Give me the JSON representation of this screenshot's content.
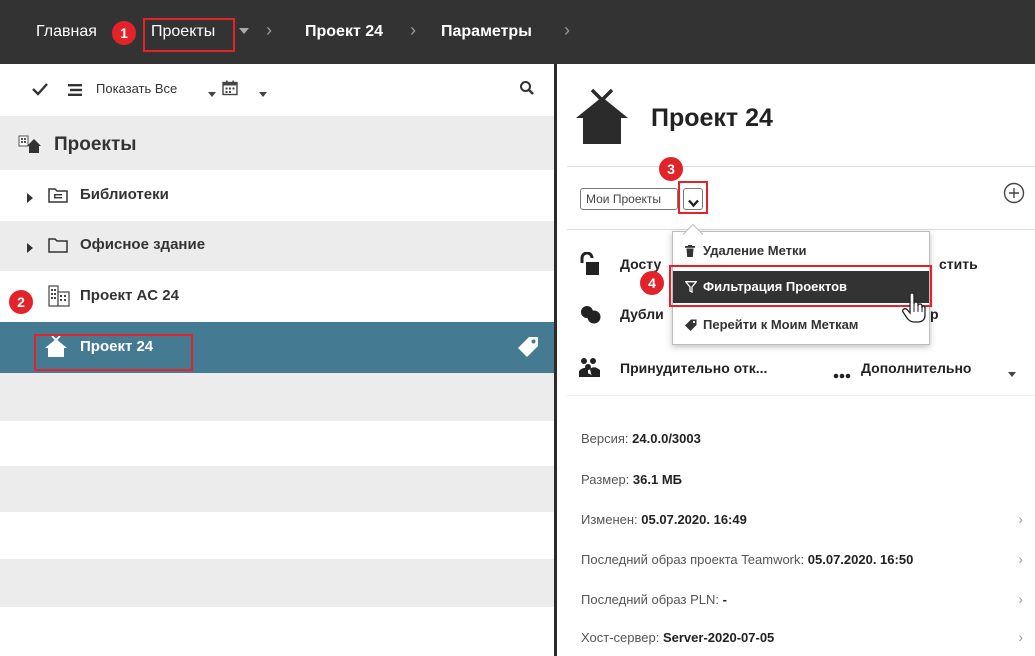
{
  "breadcrumb": {
    "home": "Главная",
    "projects": "Проекты",
    "project": "Проект 24",
    "settings": "Параметры"
  },
  "toolbar": {
    "show_all": "Показать Все"
  },
  "tree": {
    "root": "Проекты",
    "items": [
      {
        "label": "Библиотеки",
        "icon": "library-folder-icon"
      },
      {
        "label": "Офисное здание",
        "icon": "folder-icon"
      },
      {
        "label": "Проект AC 24",
        "icon": "building-icon"
      },
      {
        "label": "Проект 24",
        "icon": "house-icon",
        "selected": true
      }
    ]
  },
  "details": {
    "title": "Проект 24",
    "filter_value": "Мои Проекты",
    "action_access": "Досту",
    "action_access_tail": "стить",
    "action_duplicate": "Дубли",
    "action_duplicate_tail": "р",
    "action_force": "Принудительно отк...",
    "action_more": "Дополнительно",
    "info": [
      {
        "label": "Версия:",
        "value": "24.0.0/3003",
        "chevron": false
      },
      {
        "label": "Размер:",
        "value": "36.1 МБ",
        "chevron": false
      },
      {
        "label": "Изменен:",
        "value": "05.07.2020. 16:49",
        "chevron": true
      },
      {
        "label": "Последний образ проекта Teamwork:",
        "value": "05.07.2020. 16:50",
        "chevron": true
      },
      {
        "label": "Последний образ PLN:",
        "value": "-",
        "chevron": true
      },
      {
        "label": "Хост-сервер:",
        "value": "Server-2020-07-05",
        "chevron": true
      }
    ]
  },
  "menu": {
    "items": [
      "Удаление Метки",
      "Фильтрация Проектов",
      "Перейти к Моим Меткам"
    ]
  },
  "callouts": [
    "1",
    "2",
    "3",
    "4"
  ],
  "colors": {
    "topbar": "#333333",
    "selected_row": "#457a93",
    "callout_red": "#e2232a",
    "row_gray": "#ececec"
  }
}
